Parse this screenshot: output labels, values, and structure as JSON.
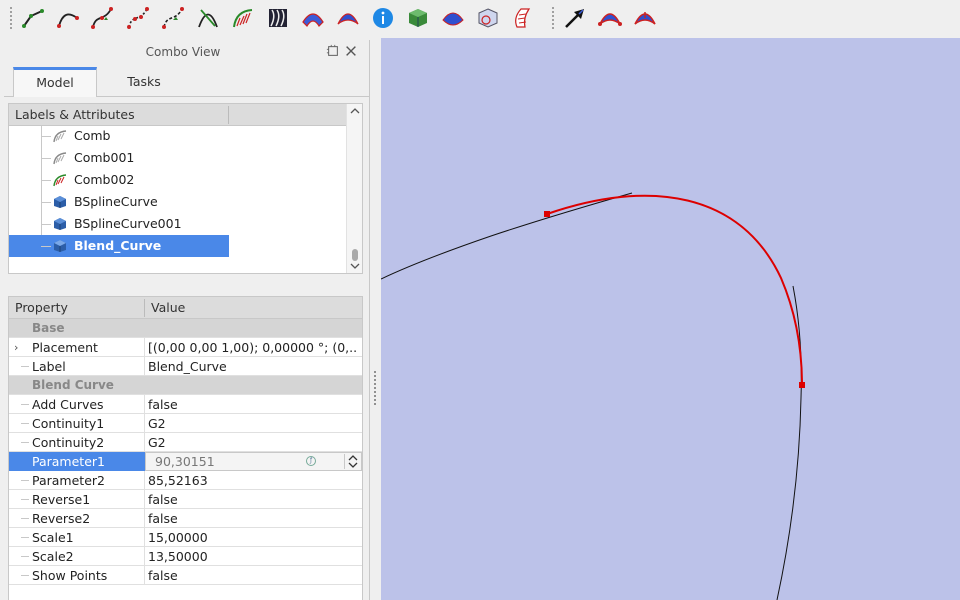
{
  "toolbar": {
    "icons": [
      "line-icon",
      "curve-arc-icon",
      "curve-interpolate-icon",
      "curve-points-icon",
      "curve-approx-icon",
      "intersection-icon",
      "comb-icon",
      "zebra-icon",
      "surface-icon",
      "blend-surface-icon",
      "info-icon",
      "solid-box-icon",
      "surface-patch-icon",
      "isocurve-icon",
      "ruled-surface-icon",
      "pointer-icon",
      "surface-red-icon",
      "surface-red2-icon"
    ]
  },
  "combo": {
    "title": "Combo View",
    "tabs": [
      "Model",
      "Tasks"
    ]
  },
  "tree": {
    "header": "Labels & Attributes",
    "items": [
      {
        "label": "Comb",
        "icon": "comb-icon",
        "selected": false
      },
      {
        "label": "Comb001",
        "icon": "comb-icon",
        "selected": false
      },
      {
        "label": "Comb002",
        "icon": "comb-icon",
        "selected": false
      },
      {
        "label": "BSplineCurve",
        "icon": "bspline-cube-icon",
        "selected": false
      },
      {
        "label": "BSplineCurve001",
        "icon": "bspline-cube-icon",
        "selected": false
      },
      {
        "label": "Blend_Curve",
        "icon": "blend-curve-cube-icon",
        "selected": true
      }
    ]
  },
  "props": {
    "header": {
      "property": "Property",
      "value": "Value"
    },
    "groups": [
      {
        "name": "Base",
        "rows": [
          {
            "name": "Placement",
            "value": "[(0,00 0,00 1,00); 0,00000 °; (0,..."
          },
          {
            "name": "Label",
            "value": "Blend_Curve"
          }
        ]
      },
      {
        "name": "Blend Curve",
        "rows": [
          {
            "name": "Add Curves",
            "value": "false"
          },
          {
            "name": "Continuity1",
            "value": "G2"
          },
          {
            "name": "Continuity2",
            "value": "G2"
          },
          {
            "name": "Parameter1",
            "value": "90,30151"
          },
          {
            "name": "Parameter2",
            "value": "85,52163"
          },
          {
            "name": "Reverse1",
            "value": "false"
          },
          {
            "name": "Reverse2",
            "value": "false"
          },
          {
            "name": "Scale1",
            "value": "15,00000"
          },
          {
            "name": "Scale2",
            "value": "13,50000"
          },
          {
            "name": "Show Points",
            "value": "false"
          }
        ]
      }
    ]
  },
  "colors": {
    "viewport_bg": "#bcc2e9",
    "selection": "#4a88e8",
    "blend_curve": "#dd0000",
    "source_curve": "#111111"
  }
}
